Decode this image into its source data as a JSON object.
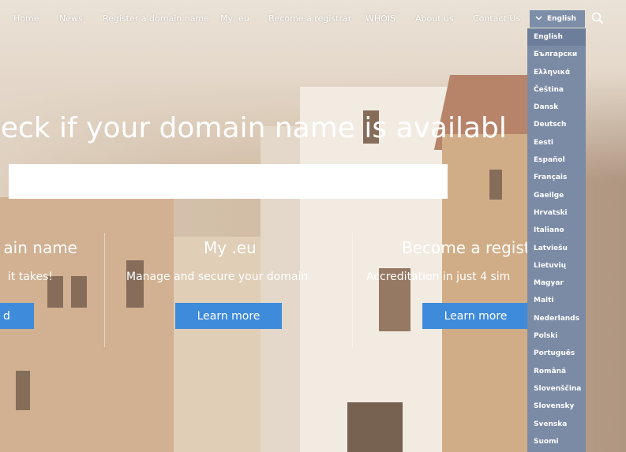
{
  "nav": {
    "items": [
      "Home",
      "News",
      "Register a domain name",
      "My .eu",
      "Become a registrar",
      "WHOIS",
      "About us",
      "Contact Us"
    ],
    "language_selected": "English"
  },
  "language_menu": {
    "options": [
      "English",
      "Български",
      "Ελληνικά",
      "Čeština",
      "Dansk",
      "Deutsch",
      "Eesti",
      "Español",
      "Français",
      "Gaeilge",
      "Hrvatski",
      "Italiano",
      "Latviešu",
      "Lietuvių",
      "Magyar",
      "Malti",
      "Nederlands",
      "Polski",
      "Português",
      "Română",
      "Slovenščina",
      "Slovensky",
      "Svenska",
      "Suomi"
    ]
  },
  "hero": {
    "headline": "heck if your domain name is available",
    "search_value": ""
  },
  "columns": [
    {
      "title": "ain name",
      "subtitle": "it takes!",
      "button": "d"
    },
    {
      "title": "My .eu",
      "subtitle": "Manage and secure your domain",
      "button": "Learn more"
    },
    {
      "title": "Become a regist",
      "subtitle": "Accreditation in just 4 sim",
      "button": "Learn more"
    }
  ],
  "colors": {
    "accent": "#3e8bdc",
    "dropdown": "#7b8ba6"
  }
}
